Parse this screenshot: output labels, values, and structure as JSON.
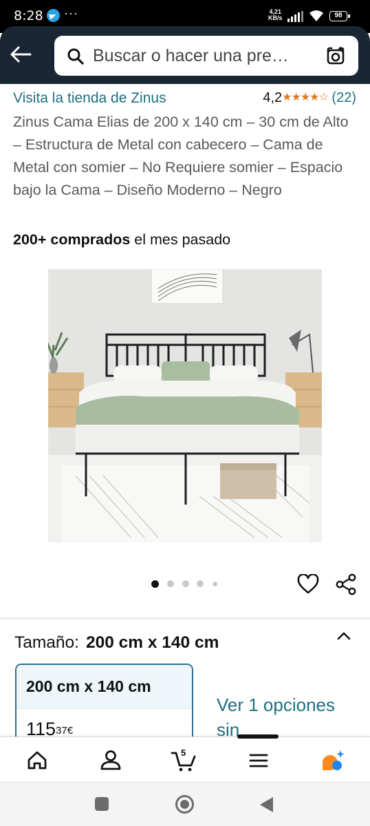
{
  "status_bar": {
    "time": "8:28",
    "notification_dots": "···",
    "net_speed_value": "4,21",
    "net_speed_unit": "KB/s",
    "battery": "98"
  },
  "search": {
    "placeholder": "Buscar o hacer una pre…",
    "icons": [
      "back-arrow-icon",
      "search-icon",
      "camera-lens-icon"
    ]
  },
  "product": {
    "store_link": "Visita la tienda de Zinus",
    "rating_value": "4,2",
    "stars_visual": "★★★★☆",
    "rating_fraction": 0.84,
    "rating_count": "(22)",
    "title": "Zinus Cama Elias de 200 x 140 cm – 30 cm de Alto – Estructura de Metal con cabecero – Cama de Metal con somier – No Requiere somier – Espacio bajo la Cama – Diseño Moderno – Negro",
    "bought_bold": "200+ comprados",
    "bought_rest": " el mes pasado"
  },
  "carousel": {
    "total_images": 5,
    "active_index": 0
  },
  "size": {
    "label": "Tamaño:",
    "selected": "200 cm x 140 cm",
    "option_name": "200 cm x 140 cm",
    "option_price_whole": "115",
    "option_price_fraction": "37€",
    "more_options": "Ver 1 opciones sin"
  },
  "bottom_nav": {
    "items": [
      "home-icon",
      "account-icon",
      "cart-icon",
      "menu-icon",
      "rufus-ai-icon"
    ],
    "cart_count": "5"
  },
  "colors": {
    "header_bg": "#1b2634",
    "link": "#1e6f80",
    "star": "#de7921",
    "selected_border": "#2c6f94"
  }
}
